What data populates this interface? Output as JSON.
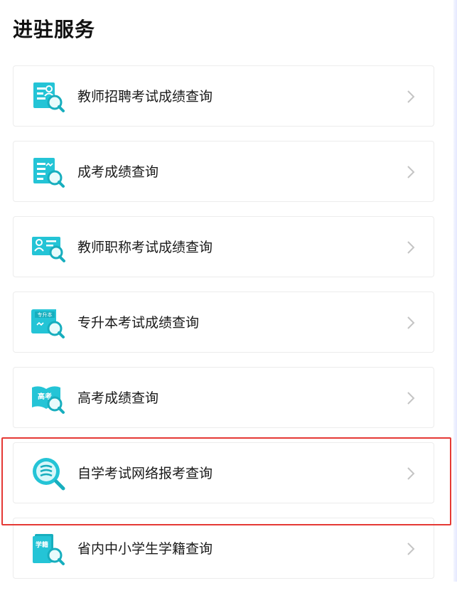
{
  "header": {
    "title": "进驻服务"
  },
  "items": [
    {
      "label": "教师招聘考试成绩查询",
      "icon": "teacher-recruit-icon"
    },
    {
      "label": "成考成绩查询",
      "icon": "adult-exam-icon"
    },
    {
      "label": "教师职称考试成绩查询",
      "icon": "teacher-title-icon"
    },
    {
      "label": "专升本考试成绩查询",
      "icon": "upgrade-exam-icon"
    },
    {
      "label": "高考成绩查询",
      "icon": "gaokao-icon"
    },
    {
      "label": "自学考试网络报考查询",
      "icon": "self-study-exam-icon"
    },
    {
      "label": "省内中小学生学籍查询",
      "icon": "student-status-icon"
    }
  ],
  "icon_texts": {
    "upgrade_badge": "专升本",
    "gaokao_badge": "高考",
    "student_badge": "学籍"
  },
  "colors": {
    "accent": "#1cbfd0",
    "highlight": "#e53935"
  }
}
